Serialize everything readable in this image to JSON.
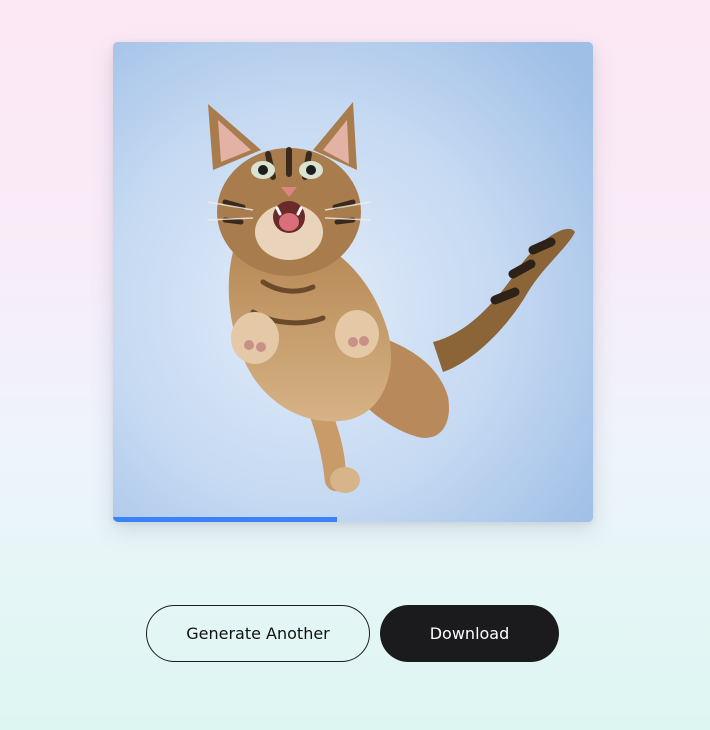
{
  "image": {
    "subject": "jumping-kitten-photo",
    "progress_percent": 46.7
  },
  "actions": {
    "generate_label": "Generate Another",
    "download_label": "Download"
  },
  "colors": {
    "progress": "#3b82f6",
    "dark_button": "#1b1b1d",
    "text": "#111111"
  }
}
